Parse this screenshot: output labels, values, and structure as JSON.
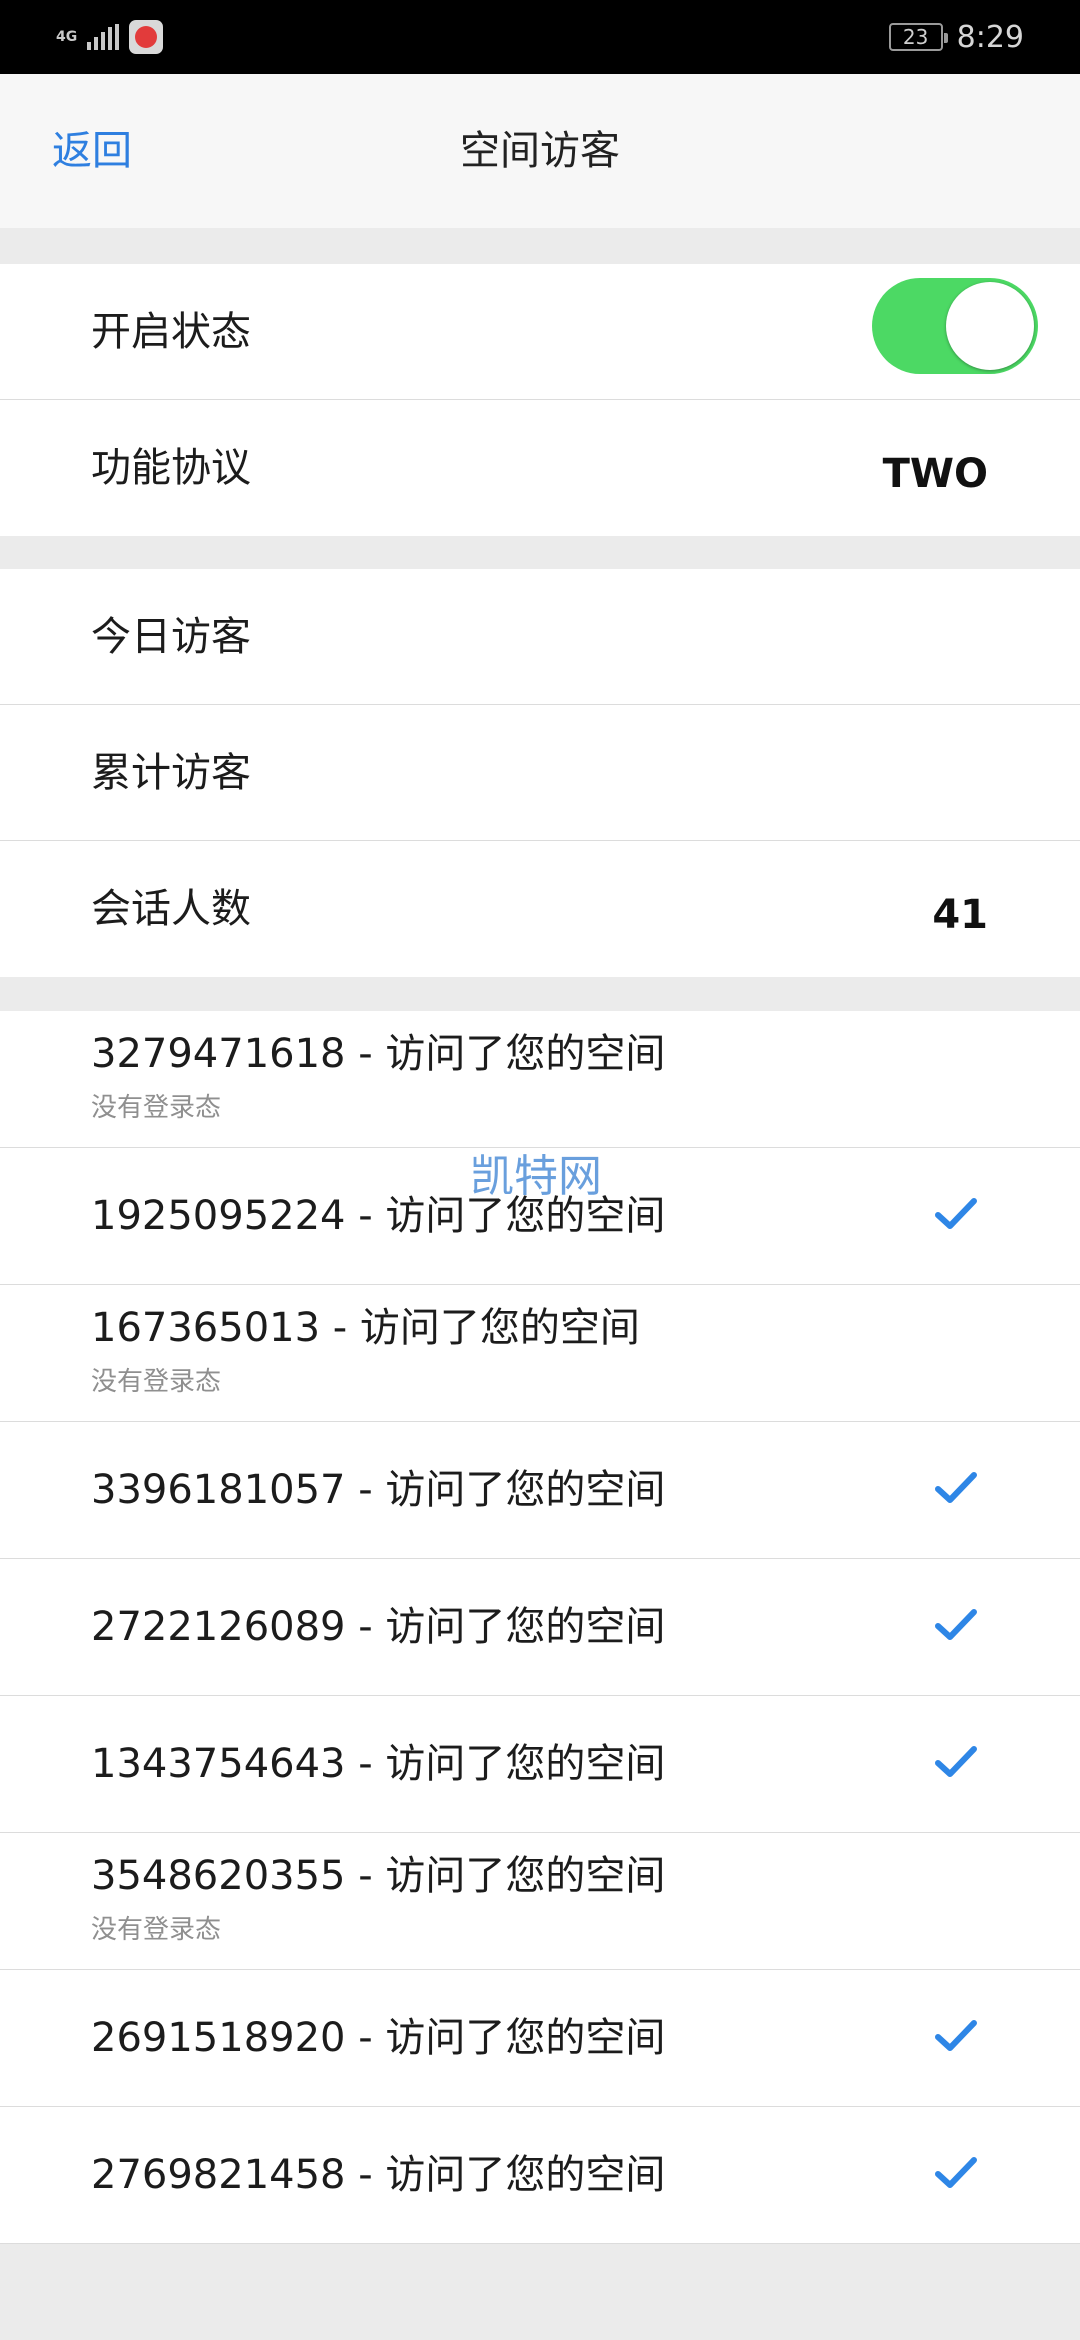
{
  "status_bar": {
    "network": "4G",
    "battery": "23",
    "time": "8:29"
  },
  "header": {
    "back_label": "返回",
    "title": "空间访客"
  },
  "settings": {
    "enabled_label": "开启状态",
    "enabled": true,
    "protocol_label": "功能协议",
    "protocol_value": "TWO"
  },
  "stats": {
    "today_label": "今日访客",
    "total_label": "累计访客",
    "sessions_label": "会话人数",
    "sessions_value": "41"
  },
  "visitors": [
    {
      "text": "3279471618 - 访问了您的空间",
      "sub": "没有登录态",
      "checked": false
    },
    {
      "text": "1925095224 - 访问了您的空间",
      "sub": "",
      "checked": true
    },
    {
      "text": "167365013 - 访问了您的空间",
      "sub": "没有登录态",
      "checked": false
    },
    {
      "text": "3396181057 - 访问了您的空间",
      "sub": "",
      "checked": true
    },
    {
      "text": "2722126089 - 访问了您的空间",
      "sub": "",
      "checked": true
    },
    {
      "text": "1343754643 - 访问了您的空间",
      "sub": "",
      "checked": true
    },
    {
      "text": "3548620355 - 访问了您的空间",
      "sub": "没有登录态",
      "checked": false
    },
    {
      "text": "2691518920 - 访问了您的空间",
      "sub": "",
      "checked": true
    },
    {
      "text": "2769821458 - 访问了您的空间",
      "sub": "",
      "checked": true
    }
  ],
  "watermark": "凯特网",
  "colors": {
    "accent": "#2e7fe0",
    "toggle_on": "#4cd964",
    "check": "#2e86e6"
  }
}
